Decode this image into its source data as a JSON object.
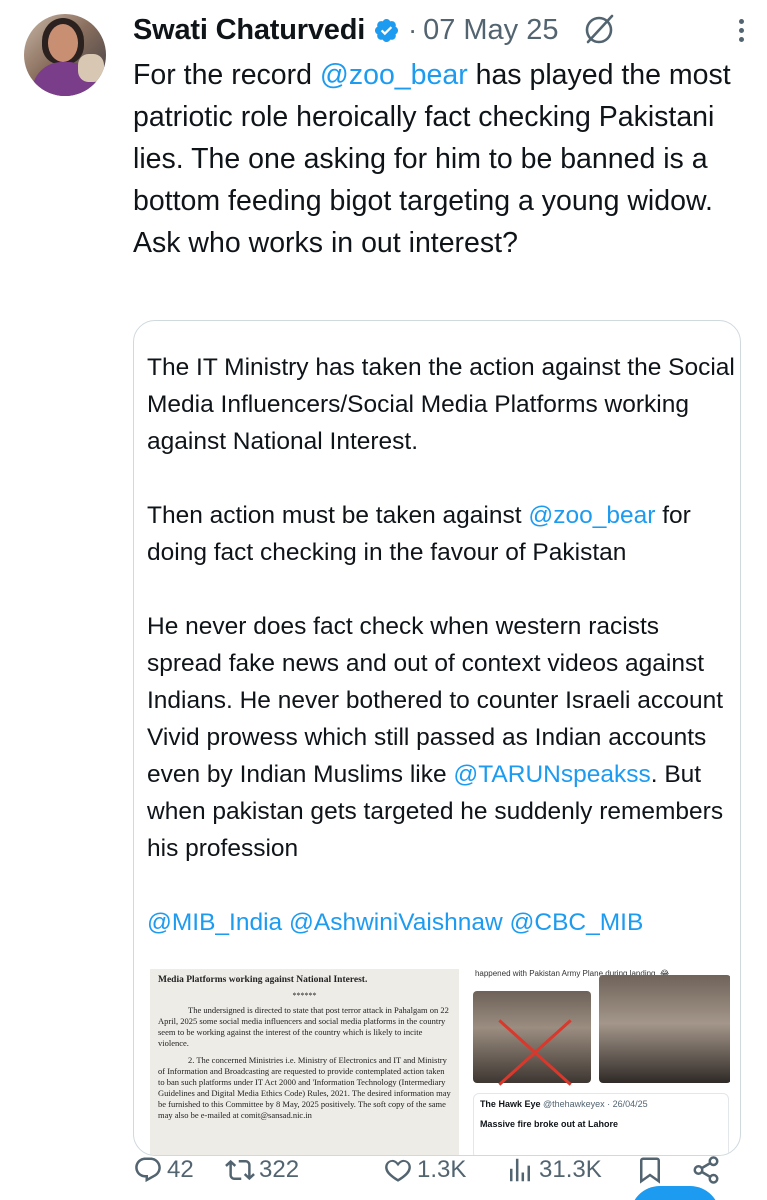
{
  "tweet": {
    "author": {
      "name": "Swati Chaturvedi",
      "verified_icon": "verified-badge-icon"
    },
    "separator": "·",
    "date": "07 May 25",
    "text": {
      "before": "For the record ",
      "mention": "@zoo_bear",
      "after": " has played the most patriotic role heroically fact checking Pakistani lies. The one asking for him to be banned is a bottom feeding bigot targeting a young widow. Ask who works in out interest?"
    }
  },
  "quote": {
    "p1": "The IT Ministry has taken the action against the Social Media Influencers/Social Media Platforms working against National Interest.",
    "p2_before": "Then action must be taken against ",
    "p2_mention": "@zoo_bear",
    "p2_after": " for doing fact checking in the favour of Pakistan",
    "p3_before": "He never does fact check when western racists spread fake news and out of context videos against Indians. He never bothered to counter Israeli account Vivid prowess which still passed as Indian accounts even by Indian Muslims like ",
    "p3_mention": "@TARUNspeakss",
    "p3_after": ". But when pakistan gets targeted he suddenly remembers his profession",
    "p4_mentions": "@MIB_India @AshwiniVaishnaw @CBC_MIB",
    "media": {
      "doc_heading": "Media Platforms working against       National Interest.",
      "doc_stars": "******",
      "doc_p1": "The undersigned is directed to state that post terror attack in Pahalgam on 22 April, 2025 some social media influencers and social media platforms in the country seem to be working against the interest of the country which is likely to incite violence.",
      "doc_p2": "2.   The concerned Ministries i.e. Ministry of Electronics and IT and Ministry of Information and Broadcasting are requested to provide contemplated action taken to ban such platforms under IT Act 2000 and 'Information Technology (Intermediary Guidelines and Digital Media Ethics Code) Rules, 2021. The desired information may be furnished to this Committee by 8 May, 2025 positively. The soft copy of the same may also be e-mailed at comit@sansad.nic.in",
      "shot_caption": "happened with Pakistan Army Plane during landing. 😂 ...",
      "card_author": "The Hawk Eye",
      "card_handle": "@thehawkeyex · 26/04/25",
      "card_headline": "Massive fire broke out at Lahore"
    }
  },
  "actions": {
    "replies": "42",
    "reposts": "322",
    "likes": "1.3K",
    "views": "31.3K"
  },
  "colors": {
    "accent": "#1d9bf0",
    "muted": "#536471",
    "text": "#0f1419",
    "border": "#cfd9de"
  }
}
